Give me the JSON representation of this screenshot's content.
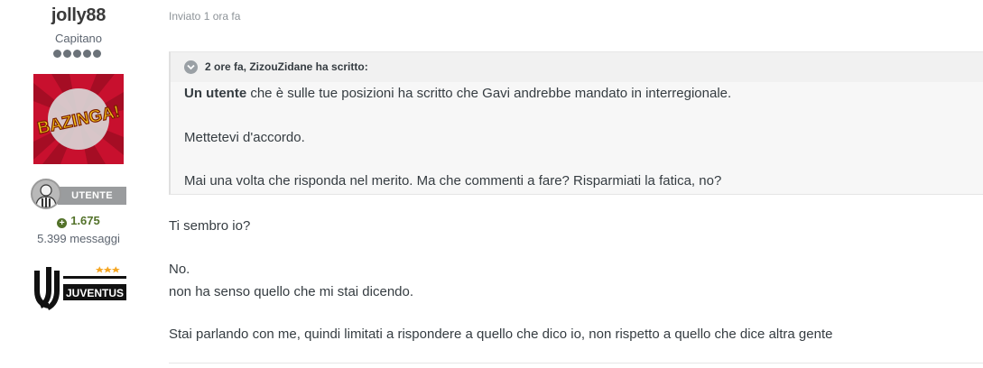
{
  "author": {
    "username": "jolly88",
    "rank_title": "Capitano",
    "rank_pips": 5,
    "avatar_text": "BAZINGA!",
    "group_badge": "UTENTE",
    "reputation": "1.675",
    "post_count": "5.399 messaggi",
    "club_logo_text": "JUVENTUS"
  },
  "post": {
    "meta": "Inviato 1 ora fa",
    "quote": {
      "citation": "2 ore fa, ZizouZidane ha scritto:",
      "lead_bold": "Un utente",
      "line1_rest": " che è sulle tue posizioni ha scritto che Gavi andrebbe mandato in interregionale.",
      "line2": "Mettetevi d'accordo.",
      "line3": "Mai una volta che risponda nel merito. Ma che commenti a fare? Risparmiati la fatica, no?"
    },
    "body": [
      "Ti sembro io?",
      "No.",
      "non ha senso quello che mi stai dicendo.",
      "Stai parlando con me, quindi limitati a rispondere a quello che dico io, non rispetto a quello che dice altra gente"
    ]
  },
  "colors": {
    "reputation_green": "#53722a",
    "avatar_red": "#c8102e",
    "badge_gray": "#9a9c9e"
  }
}
